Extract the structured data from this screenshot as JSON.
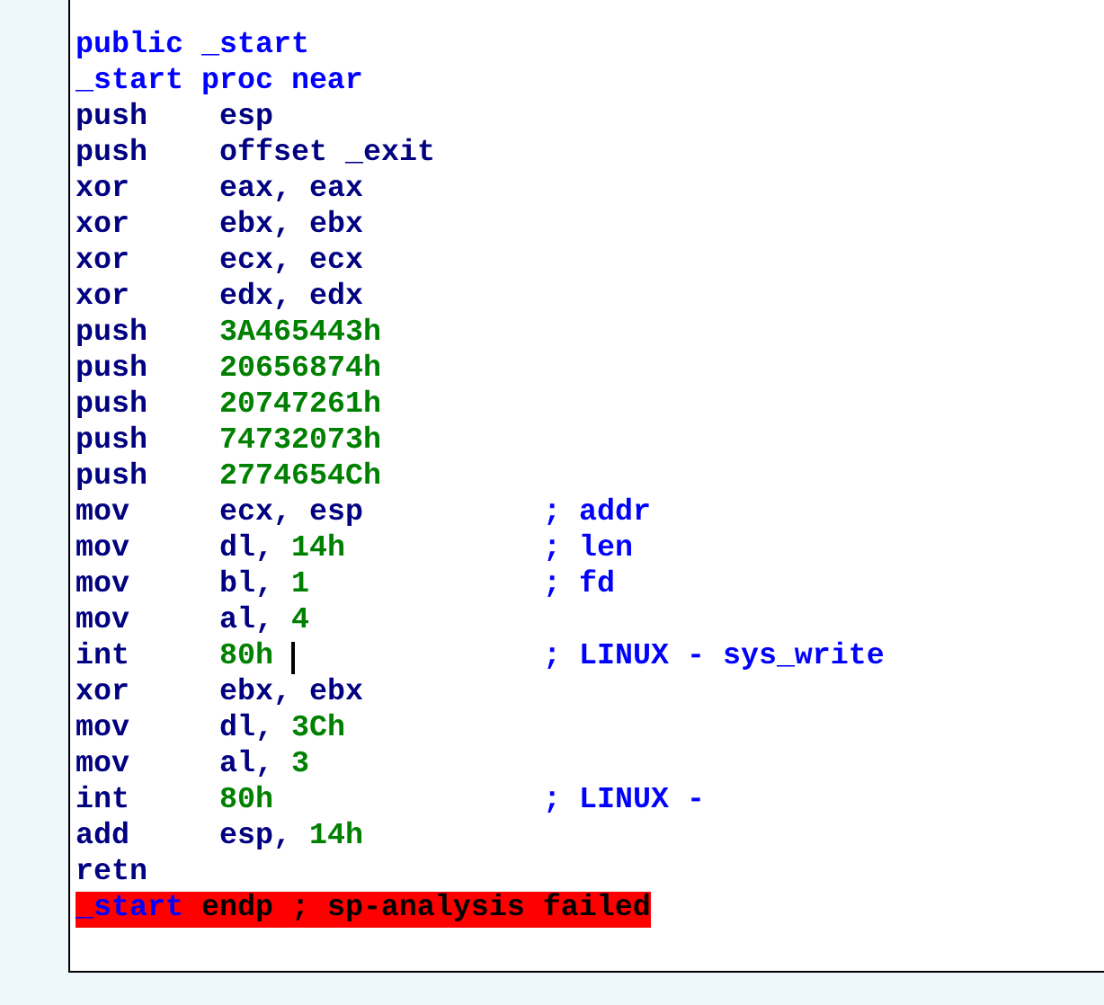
{
  "listing": [
    {
      "kind": "directive",
      "tokens": [
        {
          "text": "public _start",
          "kind": "name"
        }
      ]
    },
    {
      "kind": "directive",
      "tokens": [
        {
          "text": "_start proc near",
          "kind": "name"
        }
      ]
    },
    {
      "kind": "instruction",
      "mnemonic": "push",
      "tokens": [
        {
          "text": "esp",
          "kind": "reg"
        }
      ]
    },
    {
      "kind": "instruction",
      "mnemonic": "push",
      "tokens": [
        {
          "text": "offset _exit",
          "kind": "reg"
        }
      ]
    },
    {
      "kind": "instruction",
      "mnemonic": "xor",
      "tokens": [
        {
          "text": "eax, eax",
          "kind": "reg"
        }
      ]
    },
    {
      "kind": "instruction",
      "mnemonic": "xor",
      "tokens": [
        {
          "text": "ebx, ebx",
          "kind": "reg"
        }
      ]
    },
    {
      "kind": "instruction",
      "mnemonic": "xor",
      "tokens": [
        {
          "text": "ecx, ecx",
          "kind": "reg"
        }
      ]
    },
    {
      "kind": "instruction",
      "mnemonic": "xor",
      "tokens": [
        {
          "text": "edx, edx",
          "kind": "reg"
        }
      ]
    },
    {
      "kind": "instruction",
      "mnemonic": "push",
      "tokens": [
        {
          "text": "3A465443h",
          "kind": "num"
        }
      ]
    },
    {
      "kind": "instruction",
      "mnemonic": "push",
      "tokens": [
        {
          "text": "20656874h",
          "kind": "num"
        }
      ]
    },
    {
      "kind": "instruction",
      "mnemonic": "push",
      "tokens": [
        {
          "text": "20747261h",
          "kind": "num"
        }
      ]
    },
    {
      "kind": "instruction",
      "mnemonic": "push",
      "tokens": [
        {
          "text": "74732073h",
          "kind": "num"
        }
      ]
    },
    {
      "kind": "instruction",
      "mnemonic": "push",
      "tokens": [
        {
          "text": "2774654Ch",
          "kind": "num"
        }
      ]
    },
    {
      "kind": "instruction",
      "mnemonic": "mov",
      "tokens": [
        {
          "text": "ecx, esp",
          "kind": "reg"
        }
      ],
      "comment": "; addr"
    },
    {
      "kind": "instruction",
      "mnemonic": "mov",
      "tokens": [
        {
          "text": "dl, ",
          "kind": "reg"
        },
        {
          "text": "14h",
          "kind": "num"
        }
      ],
      "comment": "; len"
    },
    {
      "kind": "instruction",
      "mnemonic": "mov",
      "tokens": [
        {
          "text": "bl, ",
          "kind": "reg"
        },
        {
          "text": "1",
          "kind": "num"
        }
      ],
      "comment": "; fd"
    },
    {
      "kind": "instruction",
      "mnemonic": "mov",
      "tokens": [
        {
          "text": "al, ",
          "kind": "reg"
        },
        {
          "text": "4",
          "kind": "num"
        }
      ]
    },
    {
      "kind": "instruction",
      "mnemonic": "int",
      "tokens": [
        {
          "text": "80h",
          "kind": "num"
        }
      ],
      "cursor": true,
      "comment": "; LINUX - sys_write"
    },
    {
      "kind": "instruction",
      "mnemonic": "xor",
      "tokens": [
        {
          "text": "ebx, ebx",
          "kind": "reg"
        }
      ]
    },
    {
      "kind": "instruction",
      "mnemonic": "mov",
      "tokens": [
        {
          "text": "dl, ",
          "kind": "reg"
        },
        {
          "text": "3Ch",
          "kind": "num"
        }
      ]
    },
    {
      "kind": "instruction",
      "mnemonic": "mov",
      "tokens": [
        {
          "text": "al, ",
          "kind": "reg"
        },
        {
          "text": "3",
          "kind": "num"
        }
      ]
    },
    {
      "kind": "instruction",
      "mnemonic": "int",
      "tokens": [
        {
          "text": "80h",
          "kind": "num"
        }
      ],
      "comment": "; LINUX -"
    },
    {
      "kind": "instruction",
      "mnemonic": "add",
      "tokens": [
        {
          "text": "esp, ",
          "kind": "reg"
        },
        {
          "text": "14h",
          "kind": "num"
        }
      ]
    },
    {
      "kind": "instruction",
      "mnemonic": "retn"
    },
    {
      "kind": "directive",
      "error": true,
      "tokens": [
        {
          "text": "_start",
          "kind": "name"
        },
        {
          "text": " endp ; sp-analysis failed",
          "kind": "plain"
        }
      ]
    }
  ]
}
